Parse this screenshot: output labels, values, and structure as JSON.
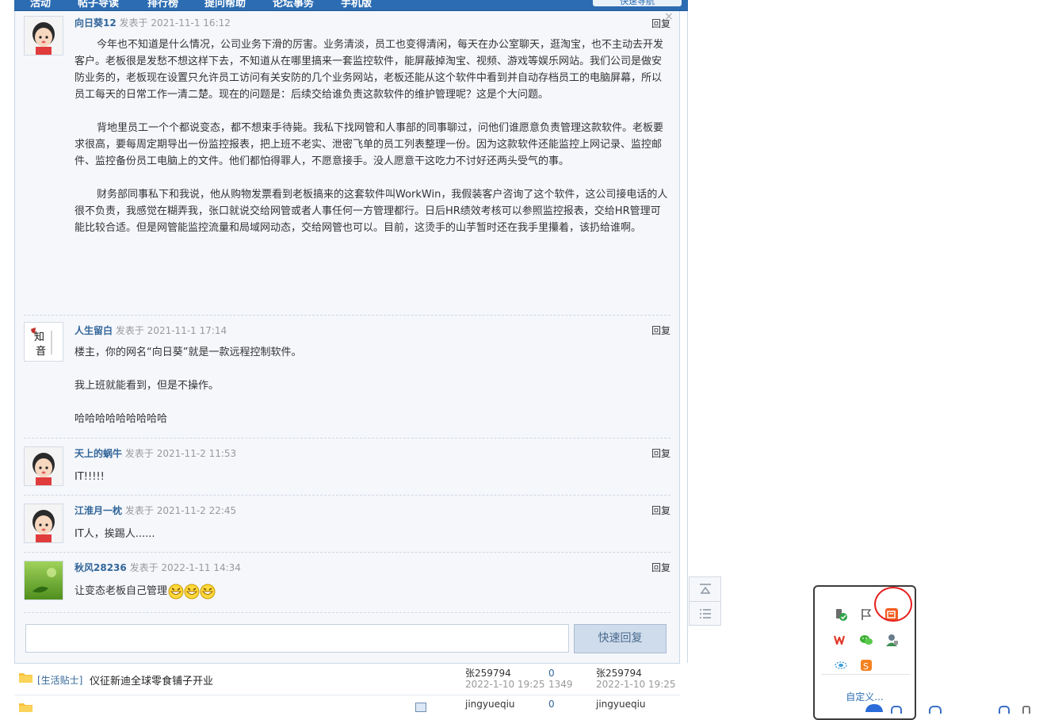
{
  "nav": {
    "items": [
      "活动",
      "帖子导读",
      "排行榜",
      "提问帮助",
      "论坛事务",
      "手机版"
    ],
    "quick_nav": "快速导航"
  },
  "posts": [
    {
      "user": "向日葵12",
      "posted_label": "发表于",
      "time": "2021-11-1 16:12",
      "reply": "回复",
      "paragraphs": [
        "今年也不知道是什么情况，公司业务下滑的厉害。业务清淡，员工也变得清闲，每天在办公室聊天，逛淘宝，也不主动去开发客户。老板很是发愁不想这样下去，不知道从在哪里搞来一套监控软件，能屏蔽掉淘宝、视频、游戏等娱乐网站。我们公司是做安防业务的，老板现在设置只允许员工访问有关安防的几个业务网站，老板还能从这个软件中看到并自动存档员工的电脑屏幕，所以员工每天的日常工作一清二楚。现在的问题是：后续交给谁负责这款软件的维护管理呢？这是个大问题。",
        "背地里员工一个个都说变态，都不想束手待毙。我私下找网管和人事部的同事聊过，问他们谁愿意负责管理这款软件。老板要求很高，要每周定期导出一份监控报表，把上班不老实、泄密飞单的员工列表整理一份。因为这款软件还能监控上网记录、监控邮件、监控备份员工电脑上的文件。他们都怕得罪人，不愿意接手。没人愿意干这吃力不讨好还两头受气的事。",
        "财务部同事私下和我说，他从购物发票看到老板搞来的这套软件叫WorkWin，我假装客户咨询了这个软件，这公司接电话的人很不负责，我感觉在糊弄我，张口就说交给网管或者人事任何一方管理都行。日后HR绩效考核可以参照监控报表，交给HR管理可能比较合适。但是网管能监控流量和局域网动态，交给网管也可以。目前，这烫手的山芋暂时还在我手里攥着，该扔给谁啊。"
      ]
    },
    {
      "user": "人生留白",
      "posted_label": "发表于",
      "time": "2021-11-1 17:14",
      "reply": "回复",
      "paragraphs": [
        "楼主，你的网名“向日葵”就是一款远程控制软件。",
        "我上班就能看到，但是不操作。",
        "哈哈哈哈哈哈哈哈哈"
      ]
    },
    {
      "user": "天上的蜗牛",
      "posted_label": "发表于",
      "time": "2021-11-2 11:53",
      "reply": "回复",
      "paragraphs": [
        "IT!!!!!"
      ]
    },
    {
      "user": "江淮月一枕",
      "posted_label": "发表于",
      "time": "2021-11-2 22:45",
      "reply": "回复",
      "paragraphs": [
        "IT人，挨踢人......"
      ]
    },
    {
      "user": "秋风28236",
      "posted_label": "发表于",
      "time": "2022-1-11 14:34",
      "reply": "回复",
      "paragraphs": [
        "让变态老板自己管理"
      ]
    }
  ],
  "quick_reply": {
    "placeholder": "",
    "button": "快速回复"
  },
  "close": "×",
  "list": [
    {
      "category": "[生活贴士]",
      "title": "仪征新迪全球零食铺子开业",
      "author": "张259794",
      "author_date": "2022-1-10 19:25",
      "replies": "0",
      "views": "1349",
      "last_user": "张259794",
      "last_date": "2022-1-10 19:25"
    },
    {
      "category": "",
      "title": "",
      "author": "jingyueqiu",
      "author_date": "",
      "replies": "0",
      "views": "",
      "last_user": "jingyueqiu",
      "last_date": ""
    }
  ],
  "tray": {
    "customize": "自定义..."
  },
  "colors": {
    "nav": "#2b6cb2",
    "link": "#336699",
    "highlight_circle": "#e62020"
  }
}
